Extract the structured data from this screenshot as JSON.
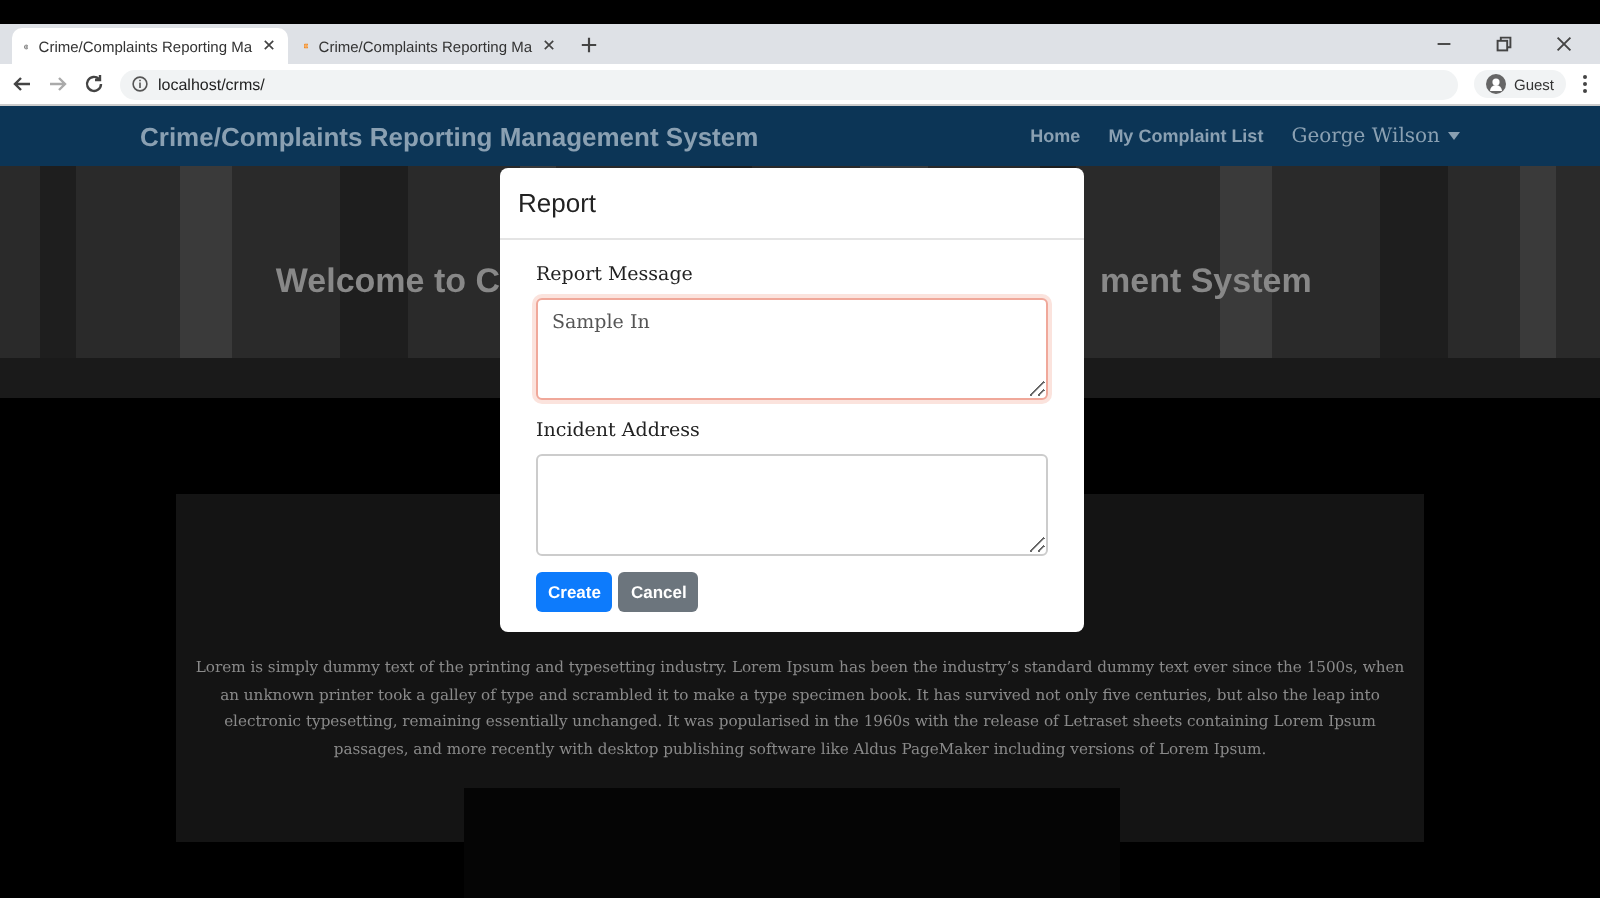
{
  "browser": {
    "tabs": [
      {
        "title": "Crime/Complaints Reporting Ma",
        "selected": true
      },
      {
        "title": "Crime/Complaints Reporting Ma",
        "selected": false
      }
    ],
    "address": "localhost/crms/",
    "profile": "Guest"
  },
  "navbar": {
    "brand": "Crime/Complaints Reporting Management System",
    "links": [
      "Home",
      "My Complaint List"
    ],
    "user": "George Wilson"
  },
  "banner": {
    "heading_left": "Welcome to C",
    "heading_right": "ment System"
  },
  "content": {
    "paragraph": "Lorem is simply dummy text of the printing and typesetting industry. Lorem Ipsum has been the industry’s standard dummy text ever since the 1500s, when an unknown printer took a galley of type and scrambled it to make a type specimen book. It has survived not only five centuries, but also the leap into electronic typesetting, remaining essentially unchanged. It was popularised in the 1960s with the release of Letraset sheets containing Lorem Ipsum passages, and more recently with desktop publishing software like Aldus PageMaker including versions of Lorem Ipsum."
  },
  "modal": {
    "title": "Report",
    "fields": [
      {
        "label": "Report Message",
        "value": "Sample In",
        "focused": true
      },
      {
        "label": "Incident Address",
        "focused": false
      }
    ],
    "buttons": [
      {
        "label": "Create",
        "kind": "primary"
      },
      {
        "label": "Cancel",
        "kind": "secondary"
      }
    ]
  }
}
